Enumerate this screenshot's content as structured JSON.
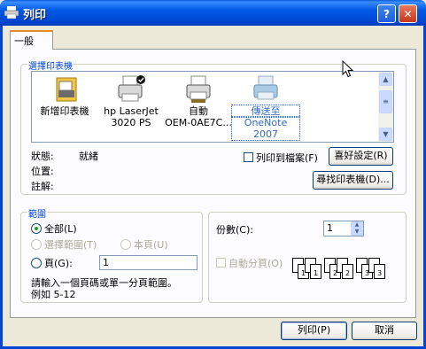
{
  "window": {
    "title": "列印",
    "help_btn": "?",
    "close_btn": "✕"
  },
  "tabs": [
    {
      "label": "一般"
    }
  ],
  "select_printer": {
    "group_label": "選擇印表機",
    "printers": [
      {
        "line1": "新增印表機",
        "line2": ""
      },
      {
        "line1": "hp LaserJet",
        "line2": "3020 PS"
      },
      {
        "line1": "自動",
        "line2": "OEM-0AE7C..."
      },
      {
        "line1": "傳送至",
        "line2": "OneNote 2007"
      }
    ],
    "status_label": "狀態:",
    "status_value": "就緒",
    "location_label": "位置:",
    "comment_label": "註解:",
    "print_to_file": "列印到檔案(F)",
    "preferences_btn": "喜好設定(R)",
    "find_printer_btn": "尋找印表機(D)..."
  },
  "page_range": {
    "group_label": "範圍",
    "all": "全部(L)",
    "selection": "選擇範圍(T)",
    "current_page": "本頁(U)",
    "pages": "頁(G):",
    "pages_value": "1",
    "hint_line1": "請輸入一個頁碼或單一分頁範圍。",
    "hint_line2": "例如 5-12"
  },
  "copies": {
    "copies_label": "份數(C):",
    "copies_value": "1",
    "collate": "自動分頁(O)",
    "page_nums": [
      "1",
      "1",
      "2",
      "2",
      "3",
      "3"
    ]
  },
  "footer": {
    "print_btn": "列印(P)",
    "cancel_btn": "取消"
  }
}
